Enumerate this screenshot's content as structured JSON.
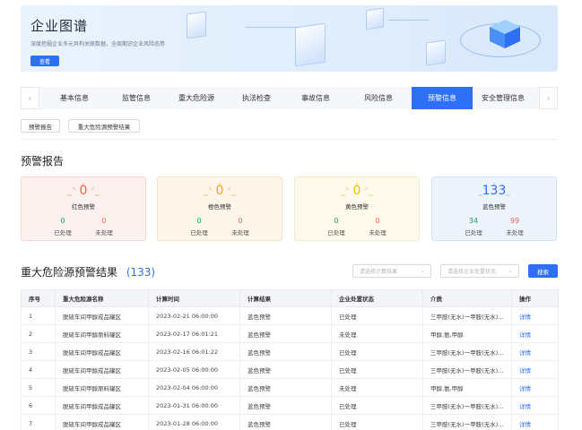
{
  "banner": {
    "title": "企业图谱",
    "description": "深度挖掘企业多元异构关联数据，全周期识企业风险态势",
    "button_label": "查看"
  },
  "tabs": {
    "items": [
      "基本信息",
      "监管信息",
      "重大危险源",
      "执法检查",
      "事故信息",
      "风险信息",
      "预警信息",
      "安全管理信息"
    ],
    "active": "预警信息"
  },
  "subtabs": [
    "预警报告",
    "重大危险源预警结果"
  ],
  "report": {
    "title": "预警报告",
    "cards": [
      {
        "value": "0",
        "label": "红色预警",
        "processed_count": "0",
        "processed_label": "已处理",
        "unprocessed_count": "0",
        "unprocessed_label": "未处理",
        "color": "#f0634f"
      },
      {
        "value": "0",
        "label": "橙色预警",
        "processed_count": "0",
        "processed_label": "已处理",
        "unprocessed_count": "0",
        "unprocessed_label": "未处理",
        "color": "#f5a623"
      },
      {
        "value": "0",
        "label": "黄色预警",
        "processed_count": "0",
        "processed_label": "已处理",
        "unprocessed_count": "0",
        "unprocessed_label": "未处理",
        "color": "#f2c200"
      },
      {
        "value": "133",
        "label": "蓝色预警",
        "processed_count": "34",
        "processed_label": "已处理",
        "unprocessed_count": "99",
        "unprocessed_label": "未处理",
        "color": "#2f6ff6"
      }
    ]
  },
  "results": {
    "title": "重大危险源预警结果",
    "count": "(133)",
    "filter1_placeholder": "请选择计算结果",
    "filter2_placeholder": "请选择企业处置状态",
    "search_label": "搜索"
  },
  "table": {
    "headers": [
      "序号",
      "重大危险源名称",
      "计算时间",
      "计算结果",
      "企业处置状态",
      "介质",
      "操作"
    ],
    "rows": [
      [
        "1",
        "脱硫车间甲醇成品罐区",
        "2023-02-21 06:00:00",
        "蓝色预警",
        "已处理",
        "三甲胺(无水)一甲胺(无水)...",
        "详情"
      ],
      [
        "2",
        "脱硫车间甲醇原料罐区",
        "2023-02-17 06:01:21",
        "蓝色预警",
        "未处理",
        "甲醇,氨,甲醇",
        "详情"
      ],
      [
        "3",
        "脱硫车间甲醇成品罐区",
        "2023-02-16 06:01:22",
        "蓝色预警",
        "已处理",
        "三甲胺(无水)一甲胺(无水)...",
        "详情"
      ],
      [
        "4",
        "脱硫车间甲醇成品罐区",
        "2023-02-05 06:00:00",
        "蓝色预警",
        "已处理",
        "三甲胺(无水)一甲胺(无水)...",
        "详情"
      ],
      [
        "5",
        "脱硫车间甲醇原料罐区",
        "2023-02-04 06:00:00",
        "蓝色预警",
        "未处理",
        "甲醇,氨,甲醇",
        "详情"
      ],
      [
        "6",
        "脱硫车间甲醇成品罐区",
        "2023-01-31 06:00:00",
        "蓝色预警",
        "已处理",
        "三甲胺(无水)一甲胺(无水)...",
        "详情"
      ],
      [
        "7",
        "脱硫车间甲醇成品罐区",
        "2023-01-28 06:00:00",
        "蓝色预警",
        "已处理",
        "三甲胺(无水)一甲胺(无水)...",
        "详情"
      ]
    ]
  }
}
